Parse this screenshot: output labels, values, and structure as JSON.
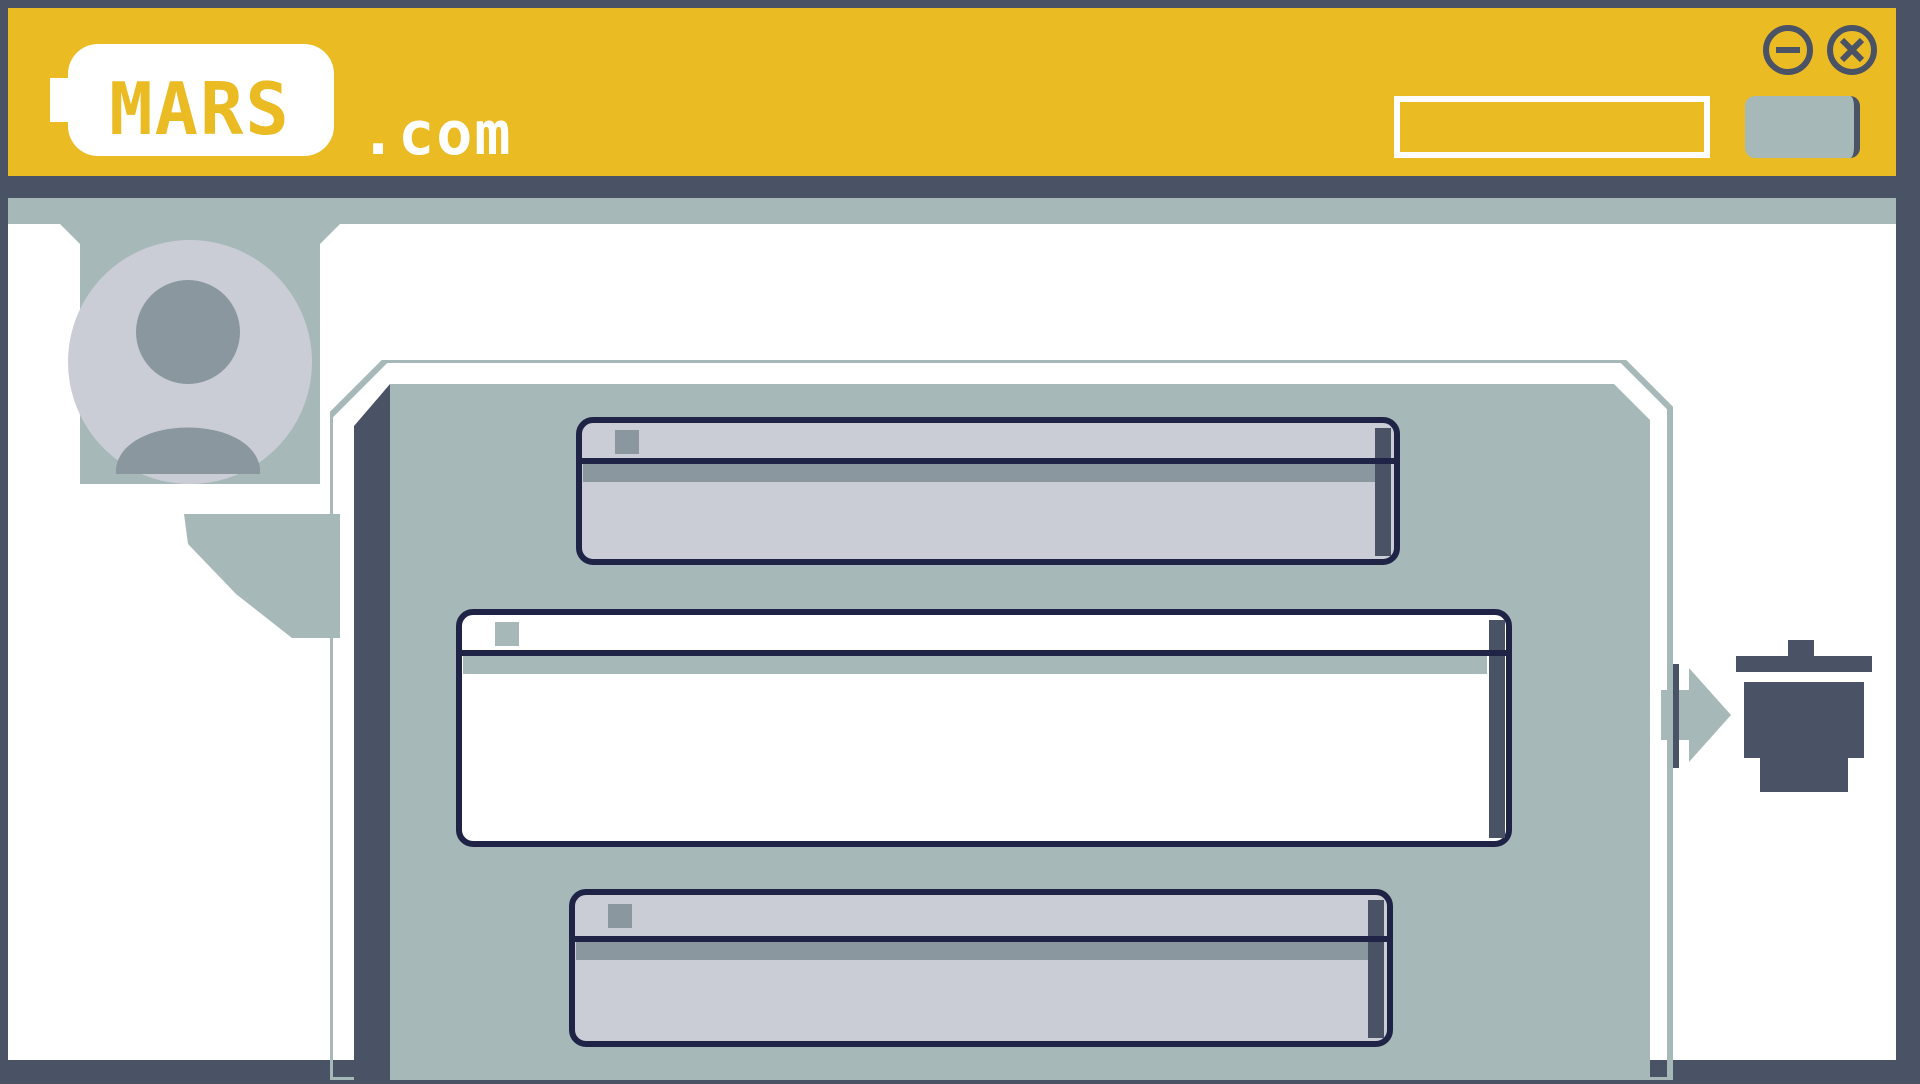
{
  "header": {
    "logo_text": "MARS",
    "domain_suffix": ".com",
    "address_bar": {
      "value": ""
    },
    "window_controls": [
      {
        "name": "minimize",
        "icon": "minus-circle-icon"
      },
      {
        "name": "close",
        "icon": "x-circle-icon"
      }
    ]
  },
  "user": {
    "avatar_icon": "user-avatar-icon"
  },
  "feed": {
    "cards": [
      {
        "state": "collapsed"
      },
      {
        "state": "selected"
      },
      {
        "state": "collapsed"
      }
    ]
  },
  "actions": {
    "delete_icon": "trash-icon",
    "drop_arrow_icon": "arrow-right-icon"
  },
  "colors": {
    "frame": "#4a5265",
    "accent": "#ebbb24",
    "panel": "#a6b9b8",
    "card": "#cbcdd6",
    "card_shadow": "#8a979f",
    "card_border": "#1f2447",
    "white": "#ffffff"
  }
}
